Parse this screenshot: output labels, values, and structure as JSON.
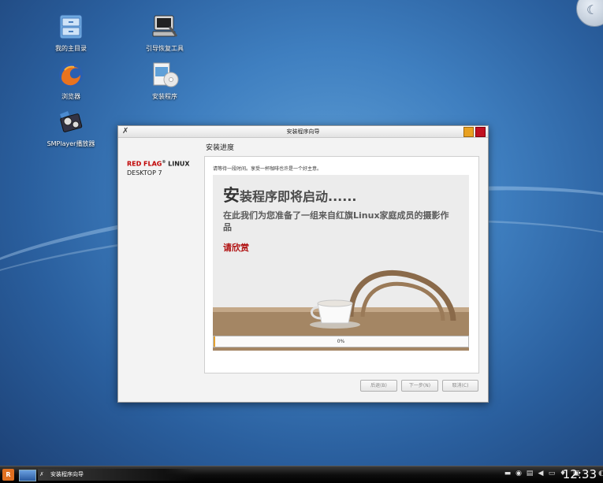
{
  "desktop": {
    "icons": [
      {
        "label": "我的主目录",
        "icon": "home-folder-icon"
      },
      {
        "label": "引导恢复工具",
        "icon": "boot-repair-icon"
      },
      {
        "label": "浏览器",
        "icon": "firefox-icon"
      },
      {
        "label": "安装程序",
        "icon": "installer-icon"
      },
      {
        "label": "SMPlayer播放器",
        "icon": "smplayer-icon"
      }
    ]
  },
  "dialog": {
    "title": "安装程序向导",
    "section_title": "安装进度",
    "brand_line1_red": "RED FLAG",
    "brand_reg": "®",
    "brand_line1_rest": " LINUX",
    "brand_line2": "DESKTOP 7",
    "wait_message": "请等待一段时间。享受一杯咖啡也许是一个好主意。",
    "slide": {
      "headline_first": "安",
      "headline_rest": "装程序即将启动......",
      "body": "在此我们为您准备了一组来自红旗Linux家庭成员的摄影作品",
      "emphasis": "请欣赏"
    },
    "progress": {
      "value": 0,
      "label": "0%"
    },
    "buttons": {
      "back": "后退(B)",
      "next": "下一步(N)",
      "cancel": "取消(C)"
    }
  },
  "taskbar": {
    "start_label": "R",
    "task_item": "安装程序向导",
    "clock": "12:33"
  },
  "colors": {
    "brand_red": "#c00000",
    "progress_fill": "#e2a030",
    "close_button": "#c01020",
    "minimize_button": "#e8a020"
  }
}
